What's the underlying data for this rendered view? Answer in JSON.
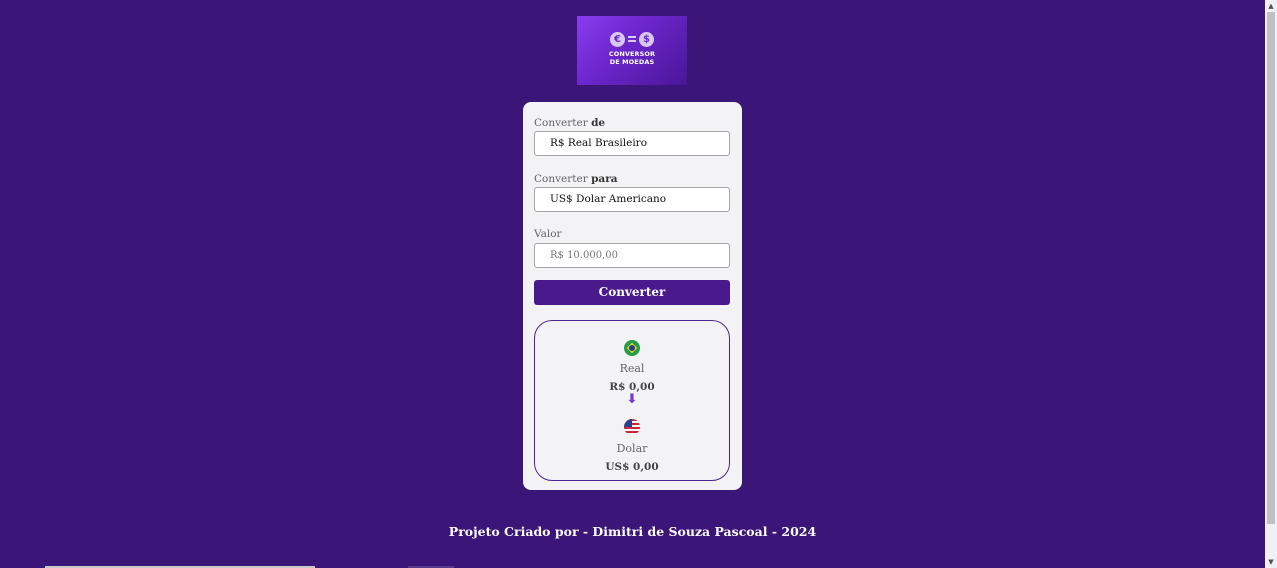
{
  "logo": {
    "line1": "CONVERSOR",
    "line2": "DE MOEDAS",
    "left_symbol": "€",
    "right_symbol": "$"
  },
  "form": {
    "from_label_prefix": "Converter",
    "from_label_bold": "de",
    "from_value": "R$ Real Brasileiro",
    "to_label_prefix": "Converter",
    "to_label_bold": "para",
    "to_value": "US$ Dolar Americano",
    "amount_label": "Valor",
    "amount_placeholder": "R$ 10.000,00",
    "convert_button": "Converter"
  },
  "result": {
    "from_flag": "brazil-flag-icon",
    "from_name": "Real",
    "from_value": "R$ 0,00",
    "arrow_icon": "arrow-down-icon",
    "to_flag": "usa-flag-icon",
    "to_name": "Dolar",
    "to_value": "US$ 0,00"
  },
  "footer": {
    "text": "Projeto Criado por - Dimitri de Souza Pascoal - 2024"
  },
  "colors": {
    "background": "#3b1578",
    "button": "#4a1a8c",
    "card": "#f3f2f4",
    "accent": "#7b38d8"
  }
}
